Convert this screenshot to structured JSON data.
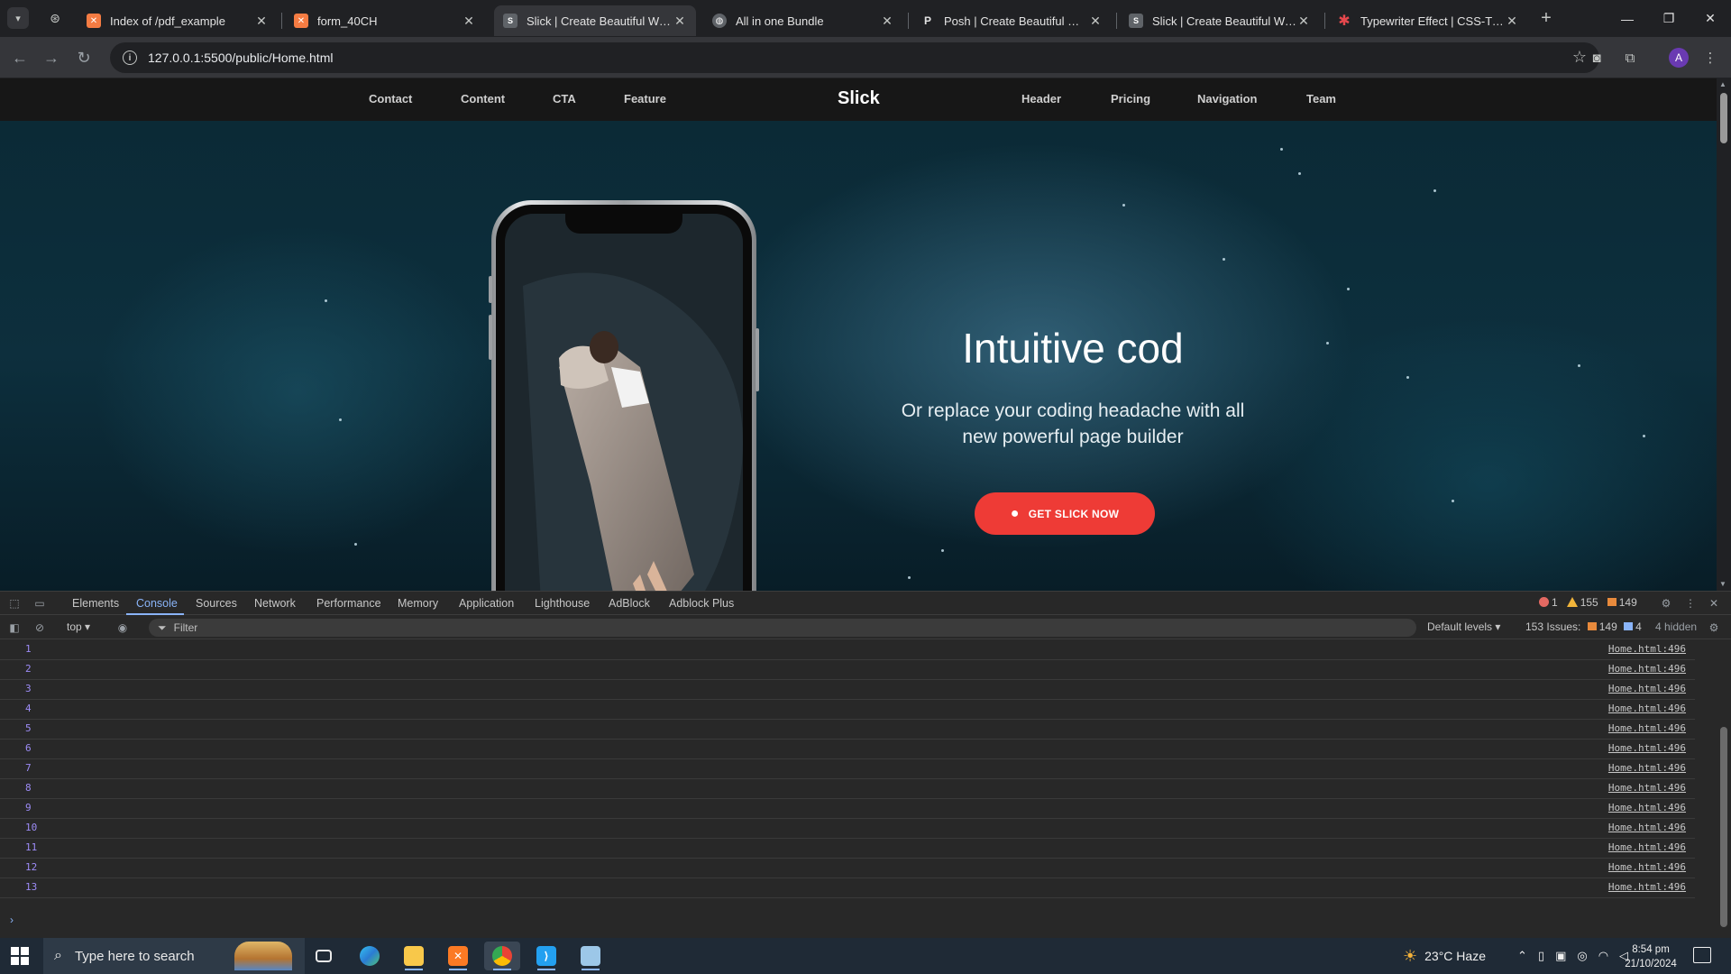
{
  "browser": {
    "tabs": [
      {
        "title": "Index of /pdf_example",
        "active": false,
        "favicon": "xampp-icon"
      },
      {
        "title": "form_40CH",
        "active": false,
        "favicon": "xampp-icon"
      },
      {
        "title": "Slick | Create Beautiful Website",
        "active": true,
        "favicon": "slick-icon"
      },
      {
        "title": "All in one Bundle",
        "active": false,
        "favicon": "globe-icon"
      },
      {
        "title": "Posh | Create Beautiful Website",
        "active": false,
        "favicon": "posh-icon"
      },
      {
        "title": "Slick | Create Beautiful Website",
        "active": false,
        "favicon": "slick-icon"
      },
      {
        "title": "Typewriter Effect | CSS-Tricks",
        "active": false,
        "favicon": "css-tricks-icon"
      }
    ],
    "url": "127.0.0.1:5500/public/Home.html",
    "profile_initial": "A"
  },
  "site": {
    "nav_left": [
      "Contact",
      "Content",
      "CTA",
      "Feature"
    ],
    "logo": "Slick",
    "nav_right": [
      "Header",
      "Pricing",
      "Navigation",
      "Team"
    ],
    "hero_title": "Intuitive cod",
    "hero_subtitle": "Or replace your coding headache with all new powerful page builder",
    "cta_label": "GET SLICK NOW",
    "accent": "#ee3b36"
  },
  "devtools": {
    "tabs": [
      "Elements",
      "Console",
      "Sources",
      "Network",
      "Performance",
      "Memory",
      "Application",
      "Lighthouse",
      "AdBlock",
      "Adblock Plus"
    ],
    "active_tab": "Console",
    "errors": "1",
    "warnings": "155",
    "info": "149",
    "context": "top",
    "filter_placeholder": "Filter",
    "levels": "Default levels",
    "issues_label": "153 Issues:",
    "issues_info": "149",
    "issues_msgs": "4",
    "hidden": "4 hidden",
    "log_rows": [
      {
        "value": "1",
        "source": "Home.html:496"
      },
      {
        "value": "2",
        "source": "Home.html:496"
      },
      {
        "value": "3",
        "source": "Home.html:496"
      },
      {
        "value": "4",
        "source": "Home.html:496"
      },
      {
        "value": "5",
        "source": "Home.html:496"
      },
      {
        "value": "6",
        "source": "Home.html:496"
      },
      {
        "value": "7",
        "source": "Home.html:496"
      },
      {
        "value": "8",
        "source": "Home.html:496"
      },
      {
        "value": "9",
        "source": "Home.html:496"
      },
      {
        "value": "10",
        "source": "Home.html:496"
      },
      {
        "value": "11",
        "source": "Home.html:496"
      },
      {
        "value": "12",
        "source": "Home.html:496"
      },
      {
        "value": "13",
        "source": "Home.html:496"
      }
    ]
  },
  "taskbar": {
    "search_placeholder": "Type here to search",
    "weather": "23°C  Haze",
    "time": "8:54 pm",
    "date": "21/10/2024"
  }
}
